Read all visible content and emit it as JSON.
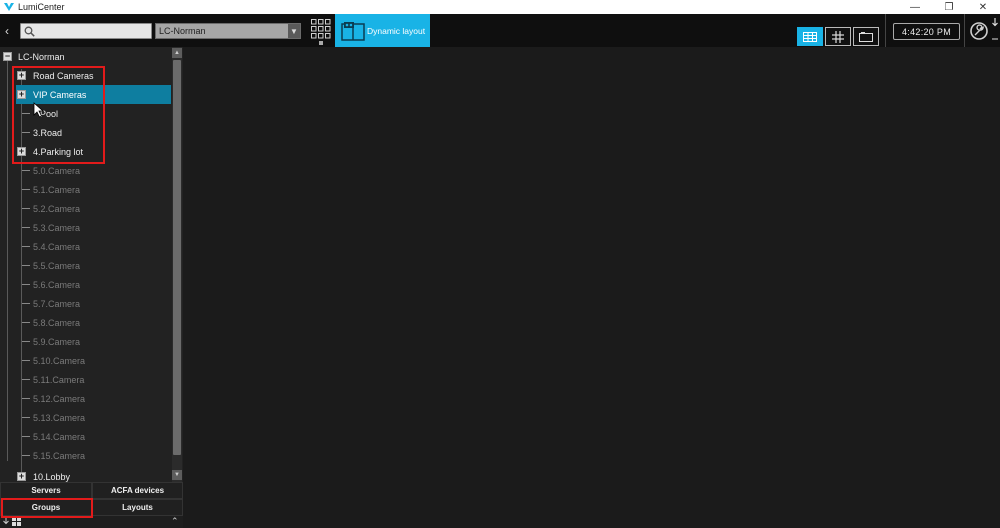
{
  "window": {
    "title": "LumiCenter",
    "minimize": "—",
    "restore": "❐",
    "close": "✕"
  },
  "toolbar": {
    "back_glyph": "‹",
    "search_placeholder": "",
    "server_value": "LC-Norman",
    "dynamic_layout_label": "Dynamic layout",
    "clock": "4:42:20 PM",
    "accent_color": "#19b3e6"
  },
  "tree": {
    "root": "LC-Norman",
    "groups": [
      {
        "label": "Road Cameras",
        "expandable": true
      },
      {
        "label": "VIP Cameras",
        "expandable": true,
        "selected": true
      },
      {
        "label": "Pool",
        "expandable": false
      },
      {
        "label": "3.Road",
        "expandable": false
      },
      {
        "label": "4.Parking lot",
        "expandable": true
      }
    ],
    "cameras": [
      "5.0.Camera",
      "5.1.Camera",
      "5.2.Camera",
      "5.3.Camera",
      "5.4.Camera",
      "5.5.Camera",
      "5.6.Camera",
      "5.7.Camera",
      "5.8.Camera",
      "5.9.Camera",
      "5.10.Camera",
      "5.11.Camera",
      "5.12.Camera",
      "5.13.Camera",
      "5.14.Camera",
      "5.15.Camera"
    ],
    "last_group": "10.Lobby"
  },
  "tabs": {
    "servers": "Servers",
    "acfa": "ACFA devices",
    "groups": "Groups",
    "layouts": "Layouts"
  },
  "icons": {
    "collapse": "−",
    "expand": "+",
    "scroll_up": "▲",
    "scroll_down": "▼",
    "caret": "▾",
    "up_double": "⌃"
  }
}
